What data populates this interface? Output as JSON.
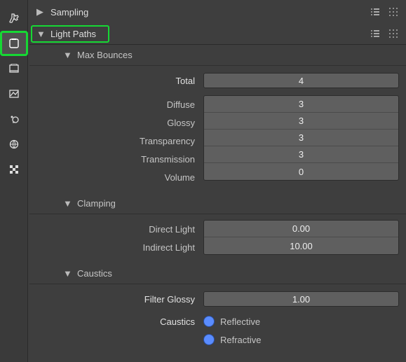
{
  "panels": {
    "sampling": {
      "title": "Sampling",
      "expanded": false
    },
    "light_paths": {
      "title": "Light Paths",
      "expanded": true
    }
  },
  "max_bounces": {
    "title": "Max Bounces",
    "total": {
      "label": "Total",
      "value": "4"
    },
    "diffuse": {
      "label": "Diffuse",
      "value": "3"
    },
    "glossy": {
      "label": "Glossy",
      "value": "3"
    },
    "transparency": {
      "label": "Transparency",
      "value": "3"
    },
    "transmission": {
      "label": "Transmission",
      "value": "3"
    },
    "volume": {
      "label": "Volume",
      "value": "0"
    }
  },
  "clamping": {
    "title": "Clamping",
    "direct": {
      "label": "Direct Light",
      "value": "0.00"
    },
    "indirect": {
      "label": "Indirect Light",
      "value": "10.00"
    }
  },
  "caustics": {
    "title": "Caustics",
    "filter_glossy": {
      "label": "Filter Glossy",
      "value": "1.00"
    },
    "caustics_label": "Caustics",
    "reflective": {
      "label": "Reflective",
      "checked": true
    },
    "refractive": {
      "label": "Refractive",
      "checked": true
    }
  },
  "vtabs": {
    "tools": "tools-tab",
    "render": "render-tab",
    "output": "output-tab",
    "image": "image-tab",
    "scene": "scene-tab",
    "world": "world-tab",
    "texture": "texture-tab"
  }
}
